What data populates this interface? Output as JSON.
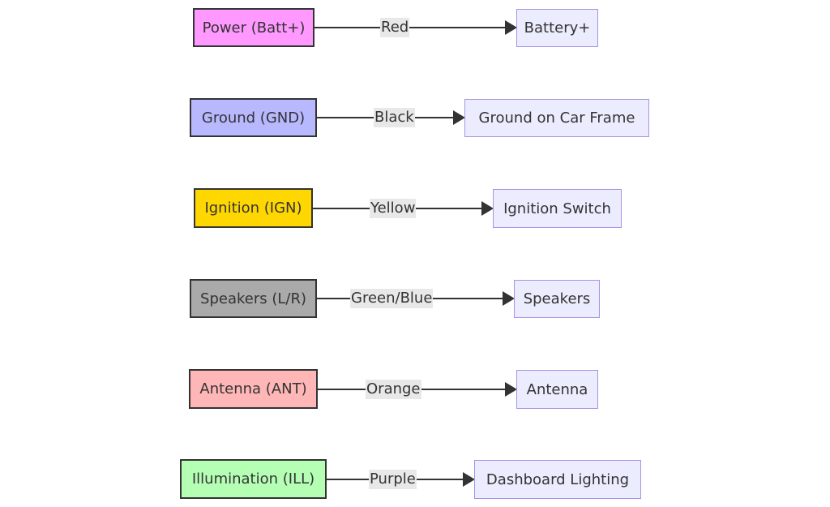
{
  "diagram": {
    "type": "flowchart",
    "direction": "left-to-right",
    "connections": [
      {
        "source": "Power (Batt+)",
        "source_color": "#ff99ff",
        "wire": "Red",
        "target": "Battery+"
      },
      {
        "source": "Ground (GND)",
        "source_color": "#b8b8ff",
        "wire": "Black",
        "target": "Ground on Car Frame"
      },
      {
        "source": "Ignition (IGN)",
        "source_color": "#ffd700",
        "wire": "Yellow",
        "target": "Ignition Switch"
      },
      {
        "source": "Speakers (L/R)",
        "source_color": "#aaaaaa",
        "wire": "Green/Blue",
        "target": "Speakers"
      },
      {
        "source": "Antenna (ANT)",
        "source_color": "#ffb6b6",
        "wire": "Orange",
        "target": "Antenna"
      },
      {
        "source": "Illumination (ILL)",
        "source_color": "#b5ffb5",
        "wire": "Purple",
        "target": "Dashboard Lighting"
      }
    ]
  }
}
